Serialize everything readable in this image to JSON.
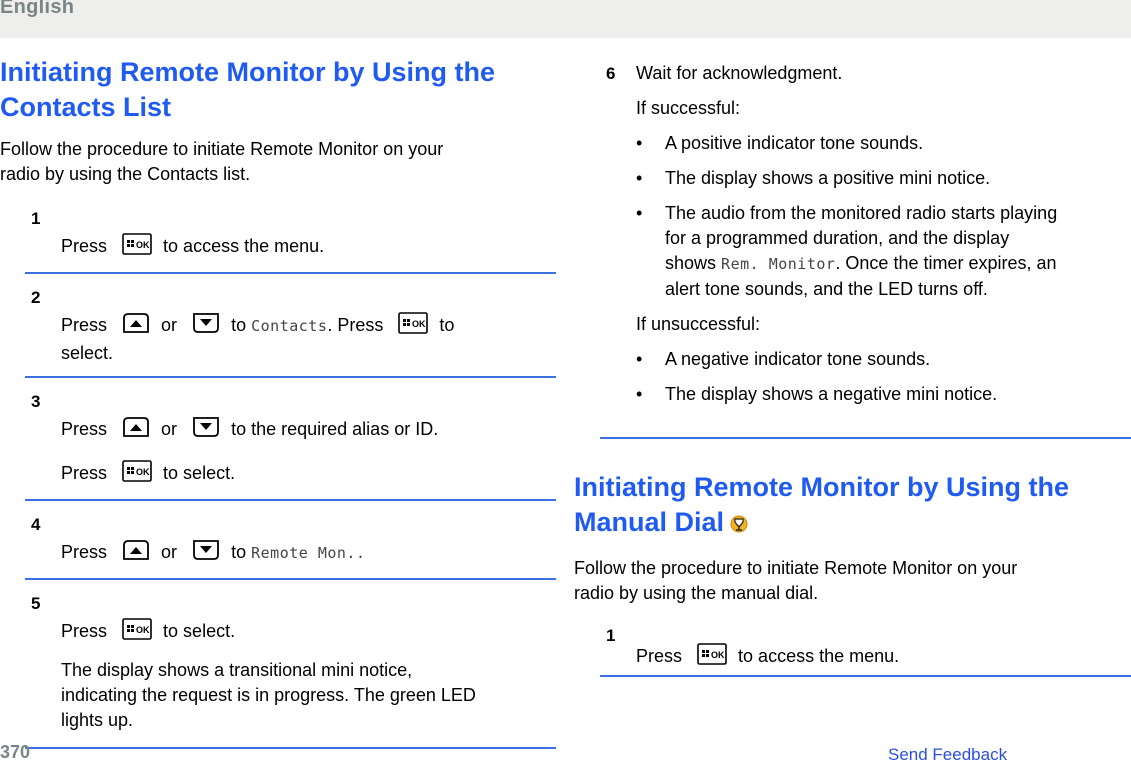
{
  "header": {
    "language": "English"
  },
  "left": {
    "title_line1": "Initiating Remote Monitor by Using the",
    "title_line2": "Contacts List",
    "intro_line1": "Follow the procedure to initiate Remote Monitor on your",
    "intro_line2": "radio by using the Contacts list.",
    "steps": [
      {
        "num": "1",
        "press": "Press",
        "after": "to access the menu."
      },
      {
        "num": "2",
        "press": "Press",
        "or": "or",
        "to": "to",
        "lcd": "Contacts",
        "mid": ". Press",
        "after": "to",
        "cont": "select."
      },
      {
        "num": "3",
        "press": "Press",
        "or": "or",
        "after": "to the required alias or ID.",
        "press2": "Press",
        "after2": "to select."
      },
      {
        "num": "4",
        "press": "Press",
        "or": "or",
        "to": "to",
        "lcd": "Remote Mon..",
        "after": ""
      },
      {
        "num": "5",
        "press": "Press",
        "after": "to select.",
        "desc_line1": "The display shows a transitional mini notice,",
        "desc_line2": "indicating the request is in progress. The green LED",
        "desc_line3": "lights up."
      }
    ]
  },
  "right": {
    "step6": {
      "num": "6",
      "text": "Wait for acknowledgment.",
      "success_label": "If successful:",
      "success_items": [
        "A positive indicator tone sounds.",
        "The display shows a positive mini notice."
      ],
      "audio_line1": "The audio from the monitored radio starts playing",
      "audio_line2": "for a programmed duration, and the display",
      "audio_line3_pre": "shows",
      "audio_line3_lcd": "Rem. Monitor",
      "audio_line3_post": ". Once the timer expires, an",
      "audio_line4": "alert tone sounds, and the LED turns off.",
      "fail_label": "If unsuccessful:",
      "fail_items": [
        "A negative indicator tone sounds.",
        "The display shows a negative mini notice."
      ],
      "bullet": "•"
    },
    "title_line1": "Initiating Remote Monitor by Using the",
    "title_line2": "Manual Dial",
    "title_icon": "feature-license-icon",
    "intro_line1": "Follow the procedure to initiate Remote Monitor on your",
    "intro_line2": "radio by using the manual dial.",
    "step1": {
      "num": "1",
      "press": "Press",
      "after": "to access the menu."
    }
  },
  "footer": {
    "page_number": "370",
    "feedback_link": "Send Feedback"
  },
  "icons": {
    "menu_ok": "menu-ok-key-icon",
    "up": "up-arrow-key-icon",
    "down": "down-arrow-key-icon"
  },
  "colors": {
    "heading": "#1f5bf0",
    "rule": "#3a70e0",
    "header_bg": "#eeeeec",
    "muted": "#7a8586",
    "link": "#2a4fe0"
  }
}
